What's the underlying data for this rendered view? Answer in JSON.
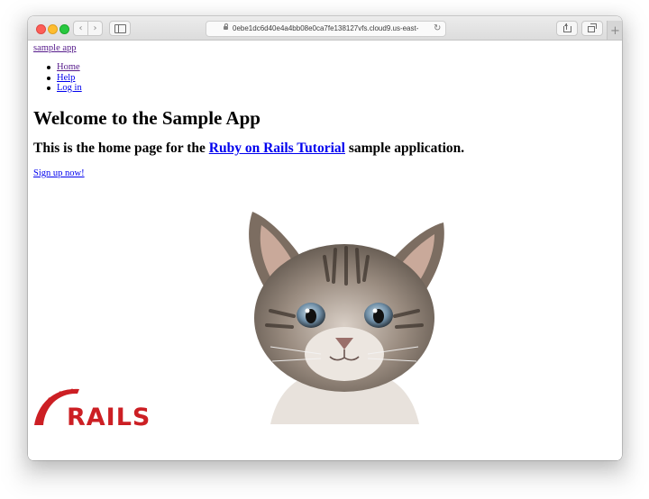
{
  "browser": {
    "url": "0ebe1dc6d40e4a4bb08e0ca7fe138127vfs.cloud9.us-east-",
    "back_glyph": "‹",
    "forward_glyph": "›",
    "reload_glyph": "↻",
    "new_tab_glyph": "+"
  },
  "page": {
    "logo_text": "sample app",
    "nav": [
      {
        "label": "Home"
      },
      {
        "label": "Help"
      },
      {
        "label": "Log in"
      }
    ],
    "heading": "Welcome to the Sample App",
    "subheading_before": "This is the home page for the ",
    "subheading_link": "Ruby on Rails Tutorial",
    "subheading_after": " sample application.",
    "signup_link": "Sign up now!",
    "rails_logo_text": "RAILS"
  },
  "colors": {
    "visited_link": "#551a8b",
    "link": "#0000ee",
    "rails_red": "#cc1f24"
  },
  "icons": [
    "back-icon",
    "forward-icon",
    "sidebar-icon",
    "lock-icon",
    "reload-icon",
    "share-icon",
    "tabs-icon",
    "new-tab-icon"
  ],
  "images": [
    "rails-logo",
    "kitten-image"
  ]
}
